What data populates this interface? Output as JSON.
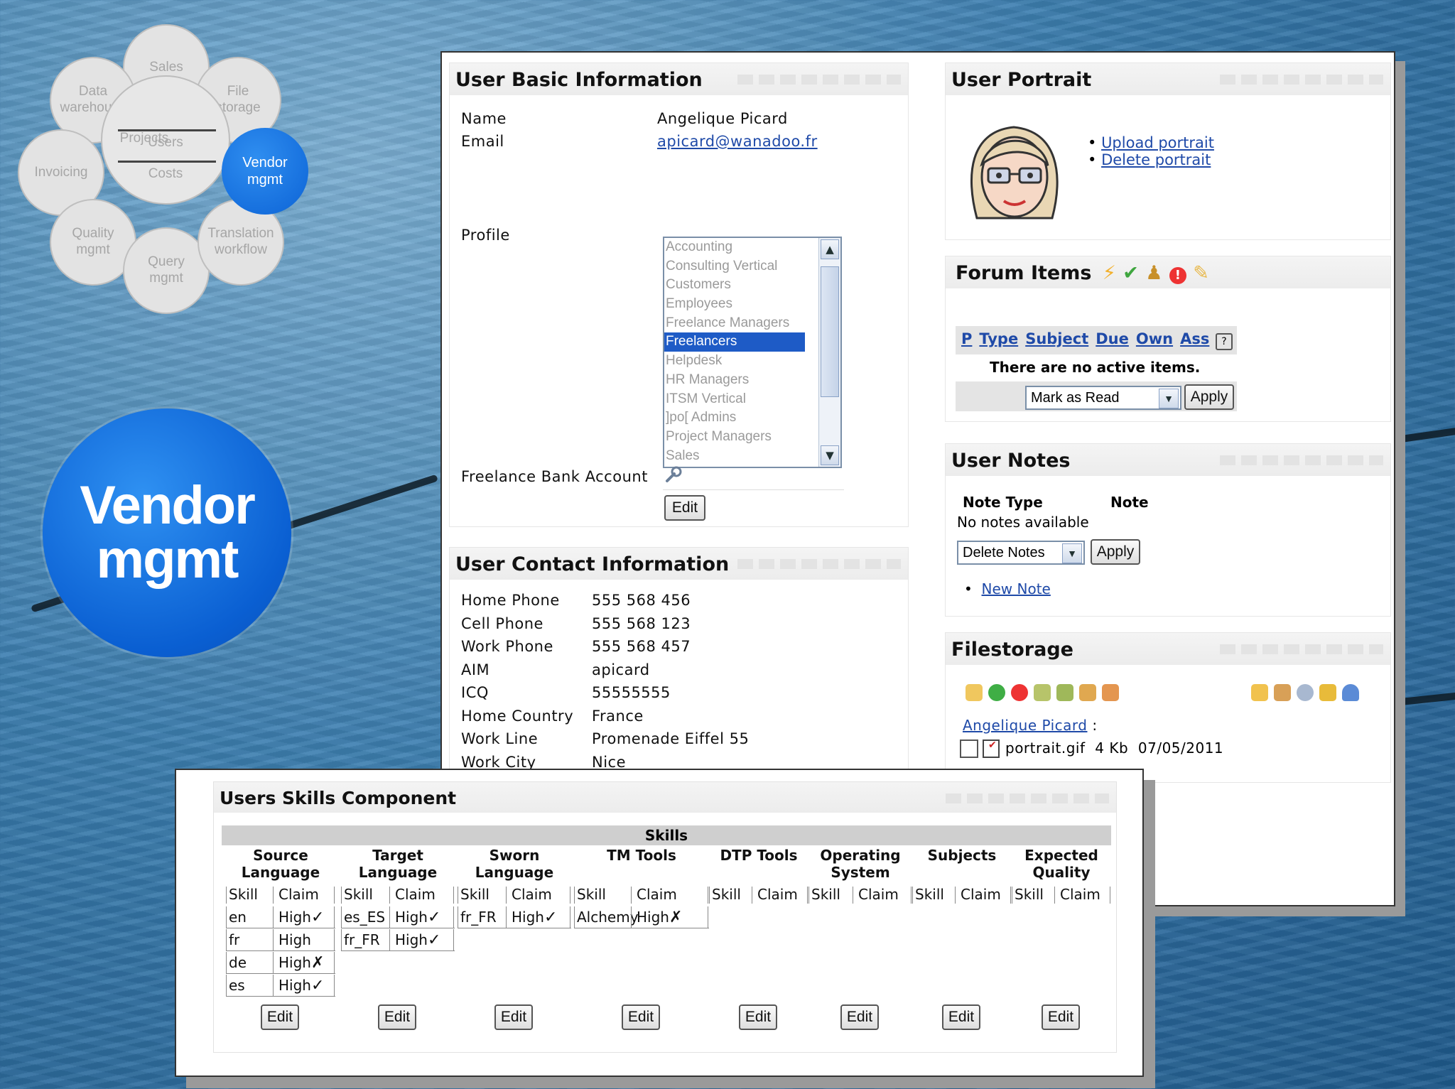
{
  "flower": {
    "petals": {
      "sales": "Sales",
      "data_warehouse": "Data\nwarehouse",
      "file_storage": "File\nstorage",
      "invoicing": "Invoicing",
      "quality": "Quality\nmgmt",
      "query": "Query\nmgmt",
      "translation": "Translation\nworkflow"
    },
    "center": {
      "projects": "Projects",
      "users": "Users",
      "costs": "Costs"
    },
    "vendor": "Vendor\nmgmt"
  },
  "badge": {
    "text": "Vendor\nmgmt"
  },
  "user_basic": {
    "title": "User Basic Information",
    "name_label": "Name",
    "name_value": "Angelique Picard",
    "email_label": "Email",
    "email_value": "apicard@wanadoo.fr",
    "profile_label": "Profile",
    "profiles": [
      "Accounting",
      "Consulting Vertical",
      "Customers",
      "Employees",
      "Freelance Managers",
      "Freelancers",
      "Helpdesk",
      "HR Managers",
      "ITSM Vertical",
      "]po[ Admins",
      "Project Managers",
      "Sales"
    ],
    "selected_profile": "Freelancers",
    "bank_label": "Freelance Bank Account",
    "edit": "Edit"
  },
  "user_contact": {
    "title": "User Contact Information",
    "rows": [
      {
        "label": "Home Phone",
        "value": "555 568 456"
      },
      {
        "label": "Cell Phone",
        "value": "555 568 123"
      },
      {
        "label": "Work Phone",
        "value": "555 568 457"
      },
      {
        "label": "AIM",
        "value": "apicard"
      },
      {
        "label": "ICQ",
        "value": "55555555"
      },
      {
        "label": "Home Country",
        "value": "France"
      },
      {
        "label": "Work Line",
        "value": "Promenade Eiffel 55"
      },
      {
        "label": "Work City",
        "value": "Nice"
      }
    ]
  },
  "portrait": {
    "title": "User Portrait",
    "upload": "Upload portrait",
    "delete": "Delete portrait"
  },
  "forum": {
    "title": "Forum Items",
    "columns": [
      "P",
      "Type",
      "Subject",
      "Due",
      "Own",
      "Ass"
    ],
    "empty": "There are no active items.",
    "action": "Mark as Read",
    "apply": "Apply"
  },
  "notes": {
    "title": "User Notes",
    "col_type": "Note Type",
    "col_note": "Note",
    "empty": "No notes available",
    "action": "Delete Notes",
    "apply": "Apply",
    "new_note": "New Note"
  },
  "filestorage": {
    "title": "Filestorage",
    "owner": "Angelique Picard",
    "owner_suffix": ":",
    "file_name": "portrait.gif",
    "file_size": "4 Kb",
    "file_date": "07/05/2011"
  },
  "skills": {
    "title": "Users Skills Component",
    "header": "Skills",
    "groups": [
      {
        "name": "Source\nLanguage",
        "skill": "Skill",
        "claim": "Claim",
        "rows": [
          [
            "en",
            "High",
            "✓"
          ],
          [
            "fr",
            "High",
            ""
          ],
          [
            "de",
            "High",
            "✗"
          ],
          [
            "es",
            "High",
            "✓"
          ]
        ]
      },
      {
        "name": "Target\nLanguage",
        "skill": "Skill",
        "claim": "Claim",
        "rows": [
          [
            "es_ES",
            "High",
            "✓"
          ],
          [
            "fr_FR",
            "High",
            "✓"
          ]
        ]
      },
      {
        "name": "Sworn\nLanguage",
        "skill": "Skill",
        "claim": "Claim",
        "rows": [
          [
            "fr_FR",
            "High",
            "✓"
          ]
        ]
      },
      {
        "name": "TM Tools",
        "skill": "Skill",
        "claim": "Claim",
        "rows": [
          [
            "Alchemy",
            "High",
            "✗"
          ]
        ]
      },
      {
        "name": "DTP Tools",
        "skill": "Skill",
        "claim": "Claim",
        "rows": []
      },
      {
        "name": "Operating\nSystem",
        "skill": "Skill",
        "claim": "Claim",
        "rows": []
      },
      {
        "name": "Subjects",
        "skill": "Skill",
        "claim": "Claim",
        "rows": []
      },
      {
        "name": "Expected\nQuality",
        "skill": "Skill",
        "claim": "Claim",
        "rows": []
      }
    ],
    "edit": "Edit"
  },
  "colors": {
    "vendor_blue": "#0c63d6",
    "selection": "#1e5bc6",
    "link": "#1f4aa8"
  }
}
